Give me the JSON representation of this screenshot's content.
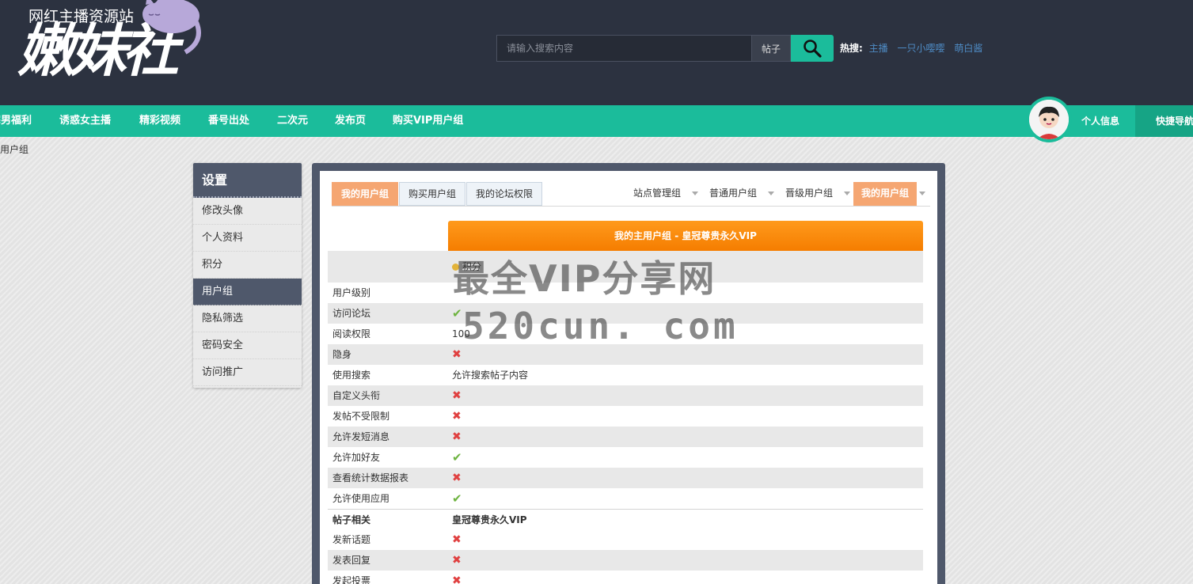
{
  "header": {
    "logo_sub": "网红主播资源站",
    "logo_main": "嫩妹社",
    "search_placeholder": "请输入搜索内容",
    "search_type": "帖子",
    "hot_label": "热搜:",
    "hot_links": [
      "主播",
      "一只小嘤嘤",
      "萌白酱"
    ]
  },
  "nav": {
    "items": [
      "宅男福利",
      "诱惑女主播",
      "精彩视频",
      "番号出处",
      "二次元",
      "发布页",
      "购买VIP用户组"
    ],
    "profile": "个人信息",
    "quick": "快捷导航"
  },
  "breadcrumb": "用户组",
  "sidebar": {
    "title": "设置",
    "items": [
      "修改头像",
      "个人资料",
      "积分",
      "用户组",
      "隐私筛选",
      "密码安全",
      "访问推广"
    ],
    "active_index": 3
  },
  "tabs": [
    "我的用户组",
    "购买用户组",
    "我的论坛权限"
  ],
  "group_tabs": [
    "站点管理组",
    "普通用户组",
    "晋级用户组",
    "我的用户组"
  ],
  "table": {
    "header": "我的主用户组 - 皇冠尊贵永久VIP",
    "score_label": "积分",
    "rows": [
      {
        "label": "用户级别",
        "value": "",
        "type": "text"
      },
      {
        "label": "访问论坛",
        "value": "✔",
        "type": "check"
      },
      {
        "label": "阅读权限",
        "value": "100",
        "type": "text"
      },
      {
        "label": "隐身",
        "value": "✖",
        "type": "cross"
      },
      {
        "label": "使用搜索",
        "value": "允许搜索帖子内容",
        "type": "text"
      },
      {
        "label": "自定义头衔",
        "value": "✖",
        "type": "cross"
      },
      {
        "label": "发帖不受限制",
        "value": "✖",
        "type": "cross"
      },
      {
        "label": "允许发短消息",
        "value": "✖",
        "type": "cross"
      },
      {
        "label": "允许加好友",
        "value": "✔",
        "type": "check"
      },
      {
        "label": "查看统计数据报表",
        "value": "✖",
        "type": "cross"
      },
      {
        "label": "允许使用应用",
        "value": "✔",
        "type": "check"
      },
      {
        "label": "帖子相关",
        "value": "皇冠尊贵永久VIP",
        "type": "section"
      },
      {
        "label": "发新话题",
        "value": "✖",
        "type": "cross"
      },
      {
        "label": "发表回复",
        "value": "✖",
        "type": "cross"
      },
      {
        "label": "发起投票",
        "value": "✖",
        "type": "cross"
      }
    ]
  },
  "watermark": {
    "line1": "最全VIP分享网",
    "line2": "520cun. com"
  },
  "colors": {
    "header_bg": "#2c3240",
    "accent": "#1bbc9b",
    "sidebar_active": "#4f586b",
    "tab_active": "#f5a672",
    "vip_orange": "#f57d00",
    "check": "#6db33f",
    "cross": "#e04040"
  }
}
